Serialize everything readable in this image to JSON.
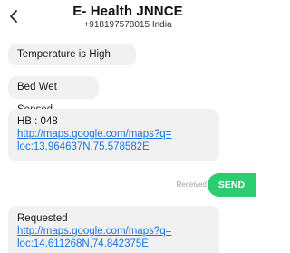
{
  "header": {
    "back_icon": "chevron-left-icon",
    "title": "E- Health JNNCE",
    "phone": "+918197578015 India"
  },
  "messages": [
    {
      "text": "Temperature is High"
    },
    {
      "text": "Bed Wet Sensed"
    },
    {
      "text": "HB : 048",
      "link_line1": "http://maps.google.com/maps?q=",
      "link_line2": "loc:13.964637N,75.578582E"
    },
    {
      "text": "Requested",
      "link_line1": "http://maps.google.com/maps?q=",
      "link_line2": "loc:14.611268N,74.842375E"
    }
  ],
  "status": {
    "label": "Received"
  },
  "send": {
    "label": "SEND",
    "color": "#2ecc71"
  },
  "colors": {
    "link": "#1a73e8",
    "bubble": "#f1f1f1"
  }
}
